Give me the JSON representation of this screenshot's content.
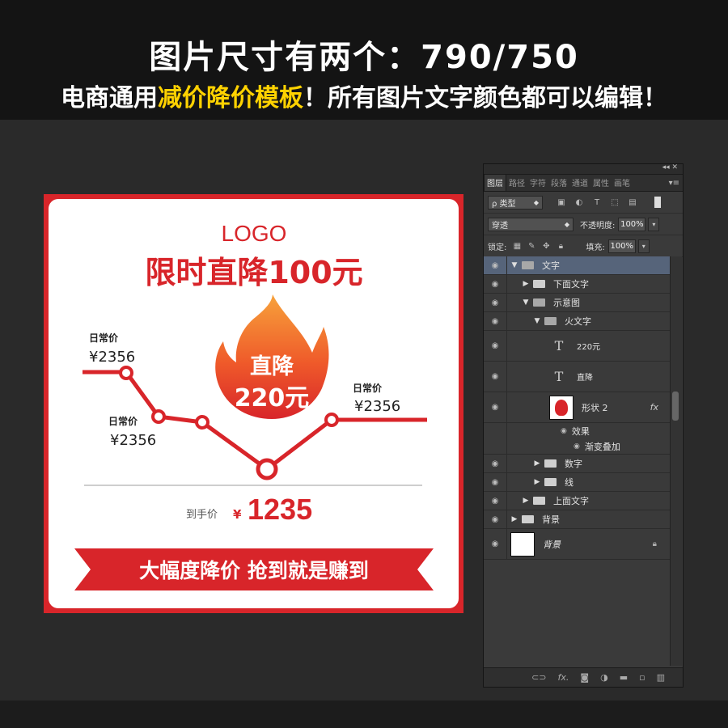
{
  "header": {
    "line1": "图片尺寸有两个：790/750",
    "line2_a": "电商通用",
    "line2_highlight": "减价降价模板",
    "line2_b": "！所有图片文字颜色都可以编辑！",
    "highlight_color": "#ffd200"
  },
  "card": {
    "logo": "LOGO",
    "title": "限时直降100元",
    "flame_line1": "直降",
    "flame_line2": "220元",
    "price_label_left": "日常价",
    "price_left": "¥2356",
    "price_label_mid": "日常价",
    "price_mid": "¥2356",
    "price_label_right": "日常价",
    "price_right": "¥2356",
    "final_label": "到手价",
    "final_currency": "¥",
    "final_price": "1235",
    "banner": "大幅度降价 抢到就是赚到",
    "accent_color": "#d8252a"
  },
  "panel": {
    "tabs": [
      "图层",
      "路径",
      "字符",
      "段落",
      "通道",
      "属性",
      "画笔"
    ],
    "filter_label": "ρ 类型",
    "blend_mode": "穿透",
    "opacity_label": "不透明度:",
    "opacity_value": "100%",
    "lock_label": "锁定:",
    "fill_label": "填充:",
    "fill_value": "100%",
    "layers": {
      "text_group": "文字",
      "lower_text": "下面文字",
      "diagram": "示意图",
      "fire_text": "火文字",
      "layer_220": "220元",
      "layer_zhijiang": "直降",
      "shape2": "形状 2",
      "fx": "fx",
      "effects": "效果",
      "gradient_overlay": "渐变叠加",
      "numbers": "数字",
      "line": "线",
      "upper_text": "上面文字",
      "bg_group": "背景",
      "bg_layer": "背景"
    },
    "footer_icons": [
      "link-icon",
      "fx-icon",
      "mask-icon",
      "adjustment-icon",
      "folder-icon",
      "new-layer-icon",
      "trash-icon"
    ]
  }
}
